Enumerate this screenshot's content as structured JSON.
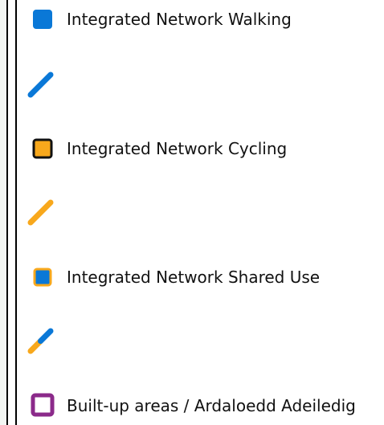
{
  "legend": {
    "items": [
      {
        "label": "Integrated Network Walking",
        "symbol": "square-icon",
        "fill": "#0a78d7",
        "stroke": "#0a78d7"
      },
      {
        "label": "",
        "symbol": "line-icon",
        "color": "#0a78d7"
      },
      {
        "label": "Integrated Network Cycling",
        "symbol": "square-icon",
        "fill": "#f8a81c",
        "stroke": "#111111"
      },
      {
        "label": "",
        "symbol": "line-icon",
        "color": "#f8a81c"
      },
      {
        "label": "Integrated Network Shared Use",
        "symbol": "square-icon",
        "fill": "#0a78d7",
        "stroke": "#f8a81c"
      },
      {
        "label": "",
        "symbol": "line-icon",
        "color_a": "#0a78d7",
        "color_b": "#f8a81c"
      },
      {
        "label": "Built-up areas / Ardaloedd Adeiledig",
        "symbol": "square-outline-icon",
        "fill": "#ffffff",
        "stroke": "#8b2a8a"
      }
    ]
  }
}
